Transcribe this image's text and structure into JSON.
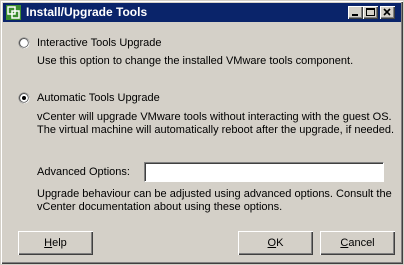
{
  "window": {
    "title": "Install/Upgrade Tools"
  },
  "options": {
    "interactive": {
      "label": "Interactive Tools Upgrade",
      "description": "Use this option to change the installed VMware tools component.",
      "selected": false
    },
    "automatic": {
      "label": "Automatic Tools Upgrade",
      "description_line1": "vCenter will upgrade VMware tools without interacting with the guest OS.",
      "description_line2": "The virtual machine will automatically reboot after the upgrade, if needed.",
      "selected": true
    }
  },
  "advanced": {
    "label": "Advanced Options:",
    "value": "",
    "help_line1": "Upgrade behaviour can be adjusted using advanced options. Consult the",
    "help_line2": "vCenter documentation about using these options."
  },
  "buttons": {
    "help_first": "H",
    "help_rest": "elp",
    "ok_first": "O",
    "ok_rest": "K",
    "cancel_first": "C",
    "cancel_rest": "ancel"
  },
  "colors": {
    "titlebar": "#0a246a",
    "face": "#d4d0c8"
  }
}
